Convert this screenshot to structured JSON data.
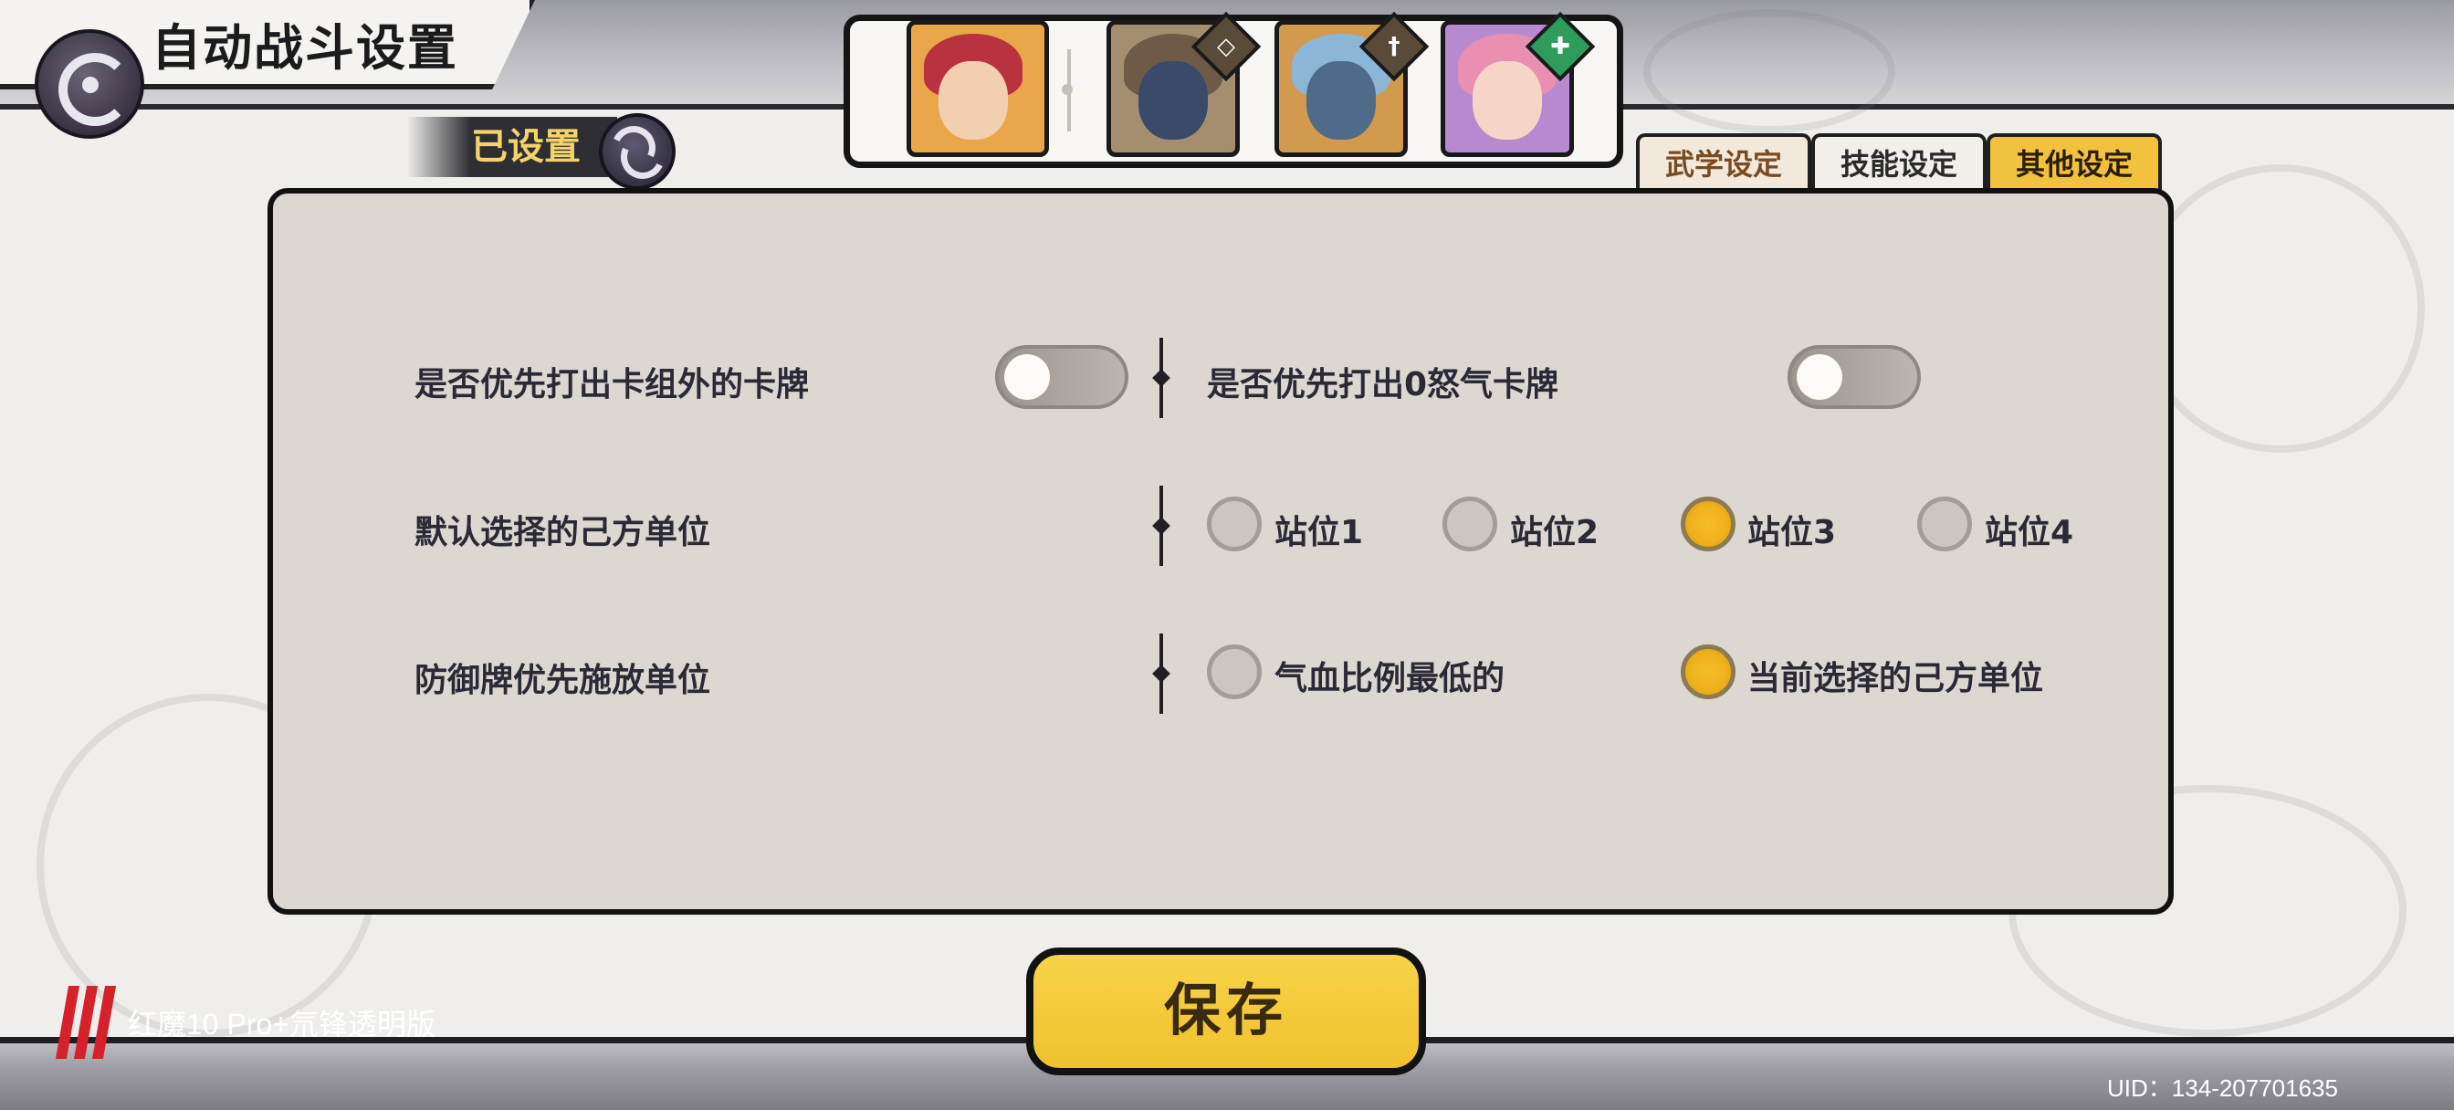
{
  "header": {
    "title": "自动战斗设置",
    "set_status": "已设置"
  },
  "tabs": [
    {
      "label": "武学设定",
      "active": false
    },
    {
      "label": "技能设定",
      "active": false
    },
    {
      "label": "其他设定",
      "active": true
    }
  ],
  "characters": [
    {
      "name": "portrait-1",
      "badge_icon": ""
    },
    {
      "name": "portrait-2",
      "badge_icon": "shield-icon"
    },
    {
      "name": "portrait-3",
      "badge_icon": "sword-icon"
    },
    {
      "name": "portrait-4",
      "badge_icon": "heal-icon"
    }
  ],
  "settings": {
    "prioritize_out_deck": {
      "label": "是否优先打出卡组外的卡牌",
      "on": false
    },
    "prioritize_zero_rage": {
      "label": "是否优先打出0怒气卡牌",
      "on": false
    },
    "default_unit": {
      "label": "默认选择的己方单位",
      "options": [
        "站位1",
        "站位2",
        "站位3",
        "站位4"
      ],
      "selected": "站位3"
    },
    "defense_target": {
      "label": "防御牌优先施放单位",
      "options": [
        "气血比例最低的",
        "当前选择的己方单位"
      ],
      "selected": "当前选择的己方单位"
    }
  },
  "save_label": "保存",
  "watermark": "红魔10 Pro+氘锋透明版",
  "uid": "UID：134-207701635",
  "colors": {
    "accent": "#f2c23e",
    "panel": "#ddd7d2",
    "selected_radio": "#f0b11e"
  }
}
